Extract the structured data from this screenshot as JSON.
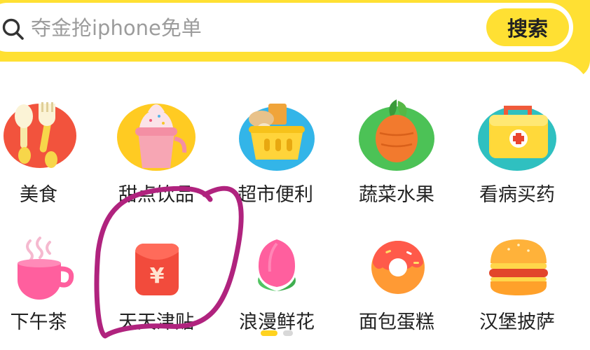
{
  "search": {
    "placeholder": "夺金抢iphone免单",
    "button_label": "搜索"
  },
  "categories": [
    {
      "label": "美食",
      "icon": "cutlery-icon"
    },
    {
      "label": "甜点饮品",
      "icon": "ice-cream-icon"
    },
    {
      "label": "超市便利",
      "icon": "shopping-basket-icon"
    },
    {
      "label": "蔬菜水果",
      "icon": "carrot-icon"
    },
    {
      "label": "看病买药",
      "icon": "medicine-box-icon"
    },
    {
      "label": "下午茶",
      "icon": "tea-cup-icon"
    },
    {
      "label": "天天津贴",
      "icon": "red-envelope-icon"
    },
    {
      "label": "浪漫鲜花",
      "icon": "flower-icon"
    },
    {
      "label": "面包蛋糕",
      "icon": "donut-icon"
    },
    {
      "label": "汉堡披萨",
      "icon": "burger-icon"
    }
  ],
  "red_envelope_symbol": "¥",
  "pagination": {
    "pages": 2,
    "current": 1
  },
  "colors": {
    "brand_yellow": "#ffe033",
    "indicator_active": "#ffd21f",
    "annotation_stroke": "#b0237e"
  }
}
